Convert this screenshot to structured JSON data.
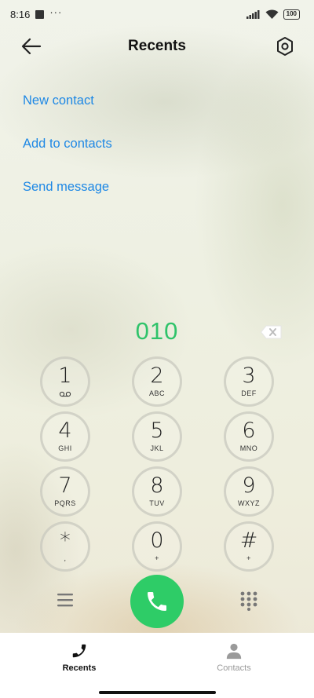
{
  "status_bar": {
    "time": "8:16",
    "dots": "···",
    "battery": "100"
  },
  "header": {
    "title": "Recents"
  },
  "actions": {
    "new_contact": "New contact",
    "add_to_contacts": "Add to contacts",
    "send_message": "Send message"
  },
  "dialer": {
    "number": "010",
    "keys": [
      {
        "digit": "1",
        "letters": ""
      },
      {
        "digit": "2",
        "letters": "ABC"
      },
      {
        "digit": "3",
        "letters": "DEF"
      },
      {
        "digit": "4",
        "letters": "GHI"
      },
      {
        "digit": "5",
        "letters": "JKL"
      },
      {
        "digit": "6",
        "letters": "MNO"
      },
      {
        "digit": "7",
        "letters": "PQRS"
      },
      {
        "digit": "8",
        "letters": "TUV"
      },
      {
        "digit": "9",
        "letters": "WXYZ"
      },
      {
        "digit": "*",
        "letters": ","
      },
      {
        "digit": "0",
        "letters": "+"
      },
      {
        "digit": "#",
        "letters": "+"
      }
    ]
  },
  "nav": {
    "recents": "Recents",
    "contacts": "Contacts"
  },
  "colors": {
    "accent_blue": "#1e88e5",
    "call_green": "#2ecc67",
    "number_green": "#2fc36a"
  },
  "icons": [
    "back-arrow-icon",
    "settings-hexagon-icon",
    "backspace-icon",
    "voicemail-icon",
    "menu-icon",
    "phone-icon",
    "dialpad-icon",
    "person-icon"
  ]
}
